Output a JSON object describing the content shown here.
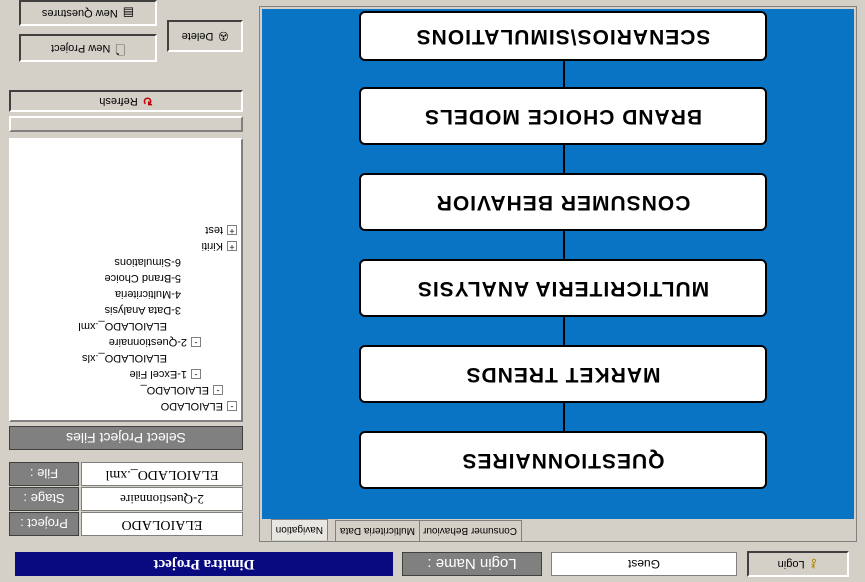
{
  "status_bar": {
    "project_title": "Dimitra Project",
    "login_name_label": "Login Name :",
    "login_name_value": "Guest",
    "login_button": "Login"
  },
  "project_info": {
    "project_label": "Project :",
    "project_value": "ELAIOLADO",
    "stage_label": "Stage :",
    "stage_value": "2-Questionnaire",
    "file_label": "File :",
    "file_value": "ELAIOLADO_.xml"
  },
  "file_browser": {
    "select_header": "Select Project Files",
    "refresh_button": "Refresh",
    "tree": [
      {
        "label": "ELAIOLADO",
        "toggle": "-"
      },
      {
        "label": "ELAIOLADO_",
        "toggle": "-"
      },
      {
        "label": "1-Excel File",
        "toggle": "-"
      },
      {
        "label": "ELAIOLADO_.xls",
        "toggle": ""
      },
      {
        "label": "2-Questionnaire",
        "toggle": "-"
      },
      {
        "label": "ELAIOLADO_.xml",
        "toggle": ""
      },
      {
        "label": "3-Data Analysis",
        "toggle": ""
      },
      {
        "label": "4-Multicriteria",
        "toggle": ""
      },
      {
        "label": "5-Brand Choice",
        "toggle": ""
      },
      {
        "label": "6-Simulations",
        "toggle": ""
      },
      {
        "label": "Kiriti",
        "toggle": "+"
      },
      {
        "label": "test",
        "toggle": "+"
      }
    ]
  },
  "toolbar": {
    "new_project": "New Project",
    "new_questionnaire": "New Questnres",
    "delete": "Delete"
  },
  "flow": {
    "steps": [
      "QUESTIONNAIRES",
      "MARKET TRENDS",
      "MULTICRITERIA ANALYSIS",
      "CONSUMER BEHAVIOR",
      "BRAND CHOICE MODELS",
      "SCENARIOS\\SIMULATIONS"
    ]
  },
  "tabs": [
    "Navigation",
    "Multicriteria Data",
    "Consumer Behaviour"
  ],
  "colors": {
    "canvas_blue": "#0a74c4",
    "title_bar_navy": "#0a0a80",
    "window_grey": "#d4d0c8"
  },
  "icons": {
    "refresh": "refresh-icon",
    "new_project": "document-icon",
    "new_questionnaire": "form-icon",
    "delete": "delete-icon",
    "login": "key-icon"
  }
}
